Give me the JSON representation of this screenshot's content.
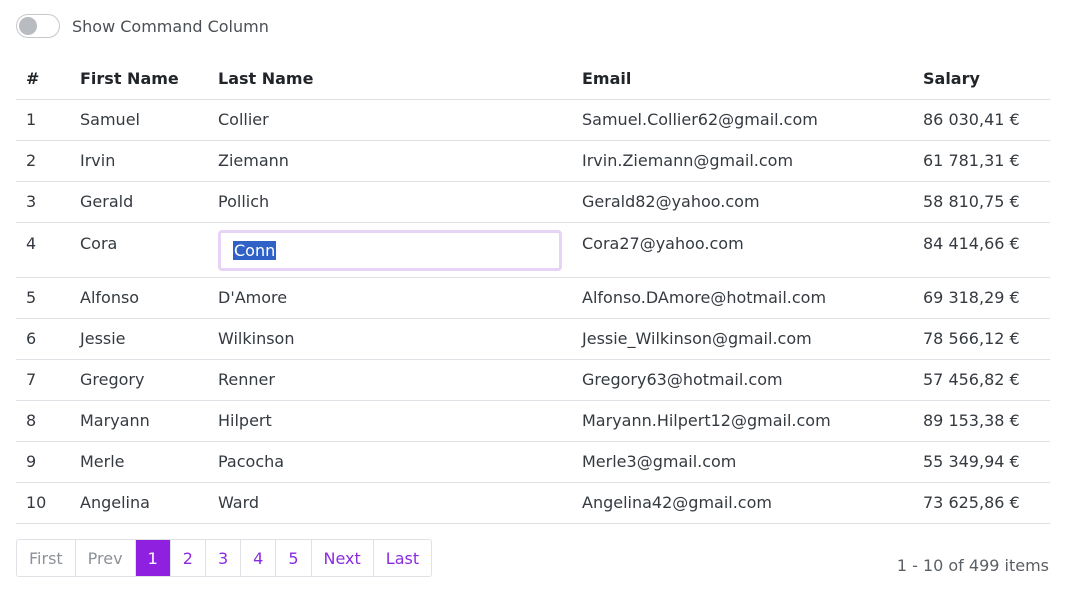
{
  "toggle": {
    "label": "Show Command Column",
    "checked": false
  },
  "table": {
    "headers": [
      "#",
      "First Name",
      "Last Name",
      "Email",
      "Salary"
    ],
    "rows": [
      [
        "1",
        "Samuel",
        "Collier",
        "Samuel.Collier62@gmail.com",
        "86 030,41 €"
      ],
      [
        "2",
        "Irvin",
        "Ziemann",
        "Irvin.Ziemann@gmail.com",
        "61 781,31 €"
      ],
      [
        "3",
        "Gerald",
        "Pollich",
        "Gerald82@yahoo.com",
        "58 810,75 €"
      ],
      [
        "4",
        "Cora",
        "Conn",
        "Cora27@yahoo.com",
        "84 414,66 €"
      ],
      [
        "5",
        "Alfonso",
        "D'Amore",
        "Alfonso.DAmore@hotmail.com",
        "69 318,29 €"
      ],
      [
        "6",
        "Jessie",
        "Wilkinson",
        "Jessie_Wilkinson@gmail.com",
        "78 566,12 €"
      ],
      [
        "7",
        "Gregory",
        "Renner",
        "Gregory63@hotmail.com",
        "57 456,82 €"
      ],
      [
        "8",
        "Maryann",
        "Hilpert",
        "Maryann.Hilpert12@gmail.com",
        "89 153,38 €"
      ],
      [
        "9",
        "Merle",
        "Pacocha",
        "Merle3@gmail.com",
        "55 349,94 €"
      ],
      [
        "10",
        "Angelina",
        "Ward",
        "Angelina42@gmail.com",
        "73 625,86 €"
      ]
    ]
  },
  "pager": {
    "first": "First",
    "prev": "Prev",
    "pages": [
      "1",
      "2",
      "3",
      "4",
      "5"
    ],
    "next": "Next",
    "last": "Last",
    "info": "1 - 10 of 499 items"
  },
  "colors": {
    "accent": "#9020e0",
    "link": "#8a2be2",
    "selection": "#2f61c7"
  }
}
